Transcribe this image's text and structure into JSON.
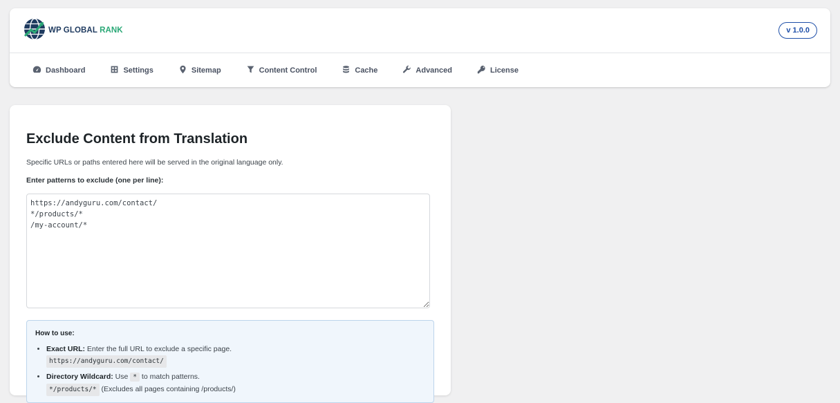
{
  "brand": {
    "part1": "WP GLOBAL",
    "part2": "RANK",
    "version": "v 1.0.0"
  },
  "colors": {
    "accent": "#1e4fa8",
    "brand_green": "#2aa876",
    "brand_navy": "#1e3a5f",
    "info_bg": "#f0f6fc"
  },
  "nav": {
    "items": [
      {
        "label": "Dashboard",
        "icon": "dashboard-icon"
      },
      {
        "label": "Settings",
        "icon": "settings-icon"
      },
      {
        "label": "Sitemap",
        "icon": "location-pin-icon"
      },
      {
        "label": "Content Control",
        "icon": "filter-icon"
      },
      {
        "label": "Cache",
        "icon": "database-icon"
      },
      {
        "label": "Advanced",
        "icon": "wrench-icon"
      },
      {
        "label": "License",
        "icon": "key-icon"
      }
    ]
  },
  "main": {
    "title": "Exclude Content from Translation",
    "description": "Specific URLs or paths entered here will be served in the original language only.",
    "field_label": "Enter patterns to exclude (one per line):",
    "patterns_value": "https://andyguru.com/contact/\n*/products/*\n/my-account/*",
    "howto": {
      "title": "How to use:",
      "items": [
        {
          "term": "Exact URL:",
          "text": " Enter the full URL to exclude a specific page.",
          "code": "https://andyguru.com/contact/",
          "after": ""
        },
        {
          "term": "Directory Wildcard:",
          "text_before": " Use ",
          "inline_code": "*",
          "text_after": " to match patterns.",
          "code": "*/products/*",
          "after": " (Excludes all pages containing /products/)"
        }
      ]
    }
  }
}
